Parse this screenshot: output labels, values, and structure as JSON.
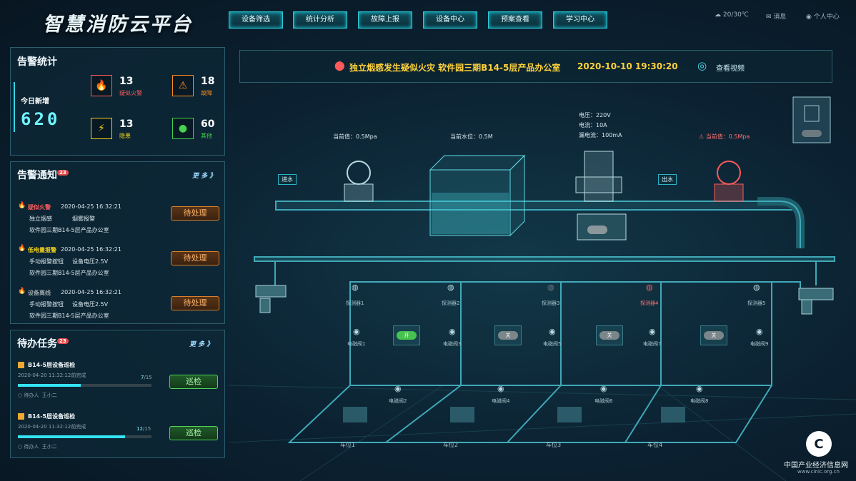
{
  "app": {
    "title": "智慧消防云平台"
  },
  "nav": [
    "设备筛选",
    "统计分析",
    "故障上报",
    "设备中心",
    "预案查看",
    "学习中心"
  ],
  "topbar": {
    "weather": "20/30℃",
    "messages": "消息",
    "user": "个人中心"
  },
  "alarm_stats": {
    "title": "告警统计",
    "today_label": "今日新增",
    "today_value": "620",
    "items": [
      {
        "count": "13",
        "label": "疑似火警",
        "color": "#ff5a5a"
      },
      {
        "count": "18",
        "label": "故障",
        "color": "#ff8a1e"
      },
      {
        "count": "13",
        "label": "隐患",
        "color": "#f2d21b"
      },
      {
        "count": "60",
        "label": "其他",
        "color": "#46d14e"
      }
    ]
  },
  "alarm_notice": {
    "title": "告警通知",
    "badge": "23",
    "more": "更 多 》",
    "items": [
      {
        "type": "疑似火警",
        "time": "2020-04-25 16:32:21",
        "d1": "独立烟感",
        "d2": "烟雾报警",
        "loc": "软件园三期B14-5层产品办公室",
        "btn": "待处理",
        "color": "#ff5a5a"
      },
      {
        "type": "低电量报警",
        "time": "2020-04-25 16:32:21",
        "d1": "手动报警按钮",
        "d2": "设备电压2.5V",
        "loc": "软件园三期B14-5层产品办公室",
        "btn": "待处理",
        "color": "#f2d21b"
      },
      {
        "type": "设备离线",
        "time": "2020-04-25 16:32:21",
        "d1": "手动报警按钮",
        "d2": "设备电压2.5V",
        "loc": "软件园三期B14-5层产品办公室",
        "btn": "待处理",
        "color": "#9aa4aa"
      }
    ]
  },
  "tasks": {
    "title": "待办任务",
    "badge": "23",
    "more": "更 多 》",
    "items": [
      {
        "name": "B14-5层设备巡检",
        "deadline": "2020-04-20 11:32:12前完成",
        "done": "7",
        "total": "/15",
        "progress": 0.47,
        "assignee_label": "待办人",
        "assignee": "王小二",
        "btn": "巡检"
      },
      {
        "name": "B14-5层设备巡检",
        "deadline": "2020-04-20 11:32:12前完成",
        "done": "12",
        "total": "/15",
        "progress": 0.8,
        "assignee_label": "待办人",
        "assignee": "王小二",
        "btn": "巡检"
      }
    ]
  },
  "alert_bar": {
    "text": "独立烟感发生疑似火灾 软件园三期B14-5层产品办公室",
    "time": "2020-10-10 19:30:20",
    "video": "查看视频"
  },
  "diagram": {
    "inlet": "进水",
    "outlet": "出水",
    "gauge1": "当前值：0.5Mpa",
    "tank": "当前水位：0.5M",
    "gauge2": "当前值：0.5Mpa",
    "pump": {
      "voltage": "电压：220V",
      "current": "电流：10A",
      "leak": "漏电流：100mA"
    },
    "detectors": [
      "探测器1",
      "探测器2",
      "探测器3",
      "探测器4",
      "探测器5"
    ],
    "valves_top": [
      "电磁阀1",
      "电磁阀3",
      "电磁阀5",
      "电磁阀7",
      "电磁阀9"
    ],
    "valves_bottom": [
      "电磁阀2",
      "电磁阀4",
      "电磁阀6",
      "电磁阀8"
    ],
    "switches": [
      {
        "label": "开",
        "on": true
      },
      {
        "label": "关",
        "on": false
      },
      {
        "label": "关",
        "on": false
      },
      {
        "label": "关",
        "on": false
      }
    ],
    "spaces": [
      "车位1",
      "车位2",
      "车位3",
      "车位4"
    ]
  },
  "watermark": {
    "name": "中国产业经济信息网",
    "url": "www.cinic.org.cn"
  }
}
